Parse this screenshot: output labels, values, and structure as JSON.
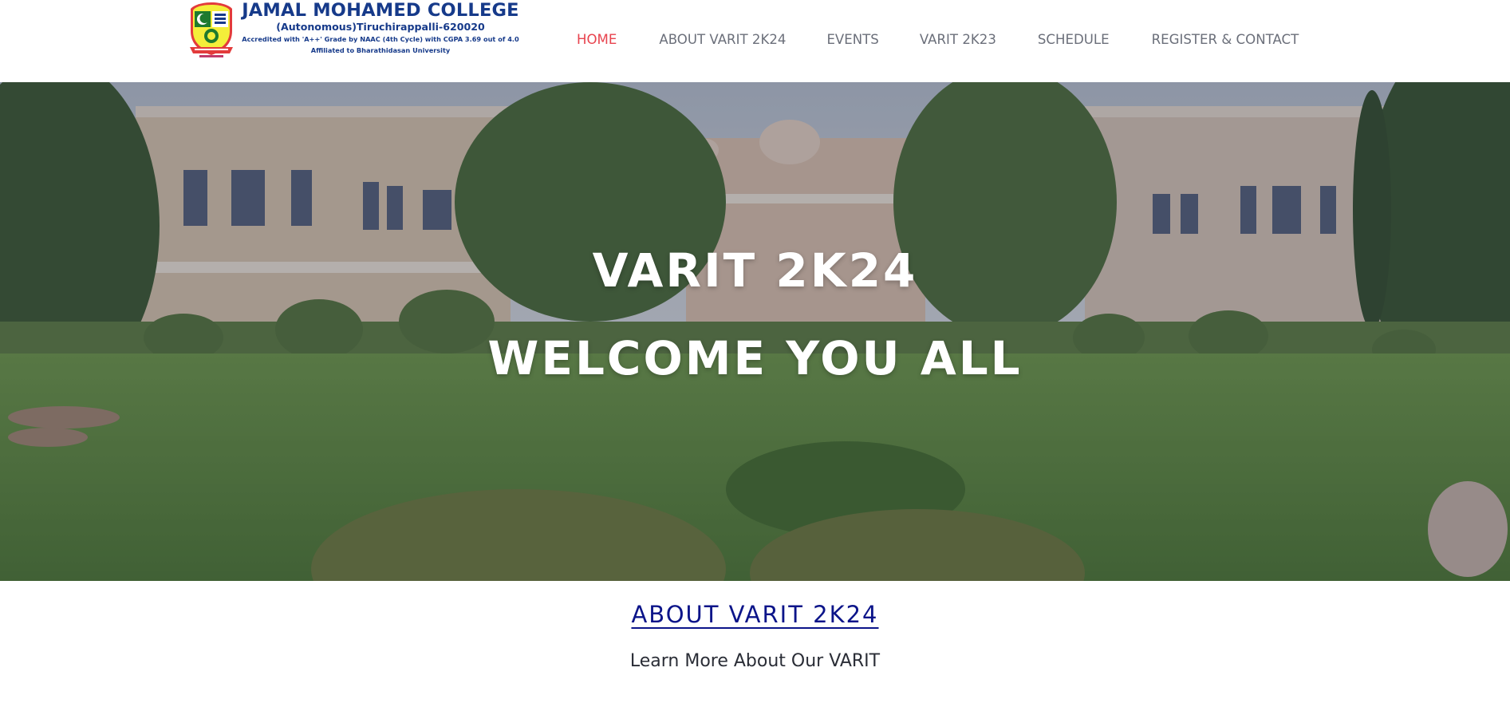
{
  "header": {
    "college_name": "JAMAL MOHAMED COLLEGE",
    "college_subtitle": "(Autonomous)Tiruchirappalli-620020",
    "accreditation": "Accredited with 'A++' Grade by NAAC (4th Cycle) with CGPA 3.69 out of 4.0",
    "affiliation": "Affiliated to Bharathidasan University",
    "logo_icon": "college-crest-icon"
  },
  "nav": {
    "items": [
      {
        "label": "HOME",
        "active": true
      },
      {
        "label": "ABOUT VARIT 2K24",
        "active": false
      },
      {
        "label": "EVENTS",
        "active": false
      },
      {
        "label": "VARIT 2K23",
        "active": false
      },
      {
        "label": "SCHEDULE",
        "active": false
      },
      {
        "label": "REGISTER & CONTACT",
        "active": false
      }
    ]
  },
  "hero": {
    "title": "VARIT 2K24",
    "subtitle": "WELCOME YOU ALL"
  },
  "about": {
    "heading": "ABOUT VARIT 2K24",
    "lead": "Learn More About Our VARIT"
  },
  "colors": {
    "nav_text": "#6b6f7a",
    "nav_active": "#e8434e",
    "college_blue": "#163a8a",
    "about_heading": "#0b1489",
    "body_text": "#2a2d36"
  }
}
